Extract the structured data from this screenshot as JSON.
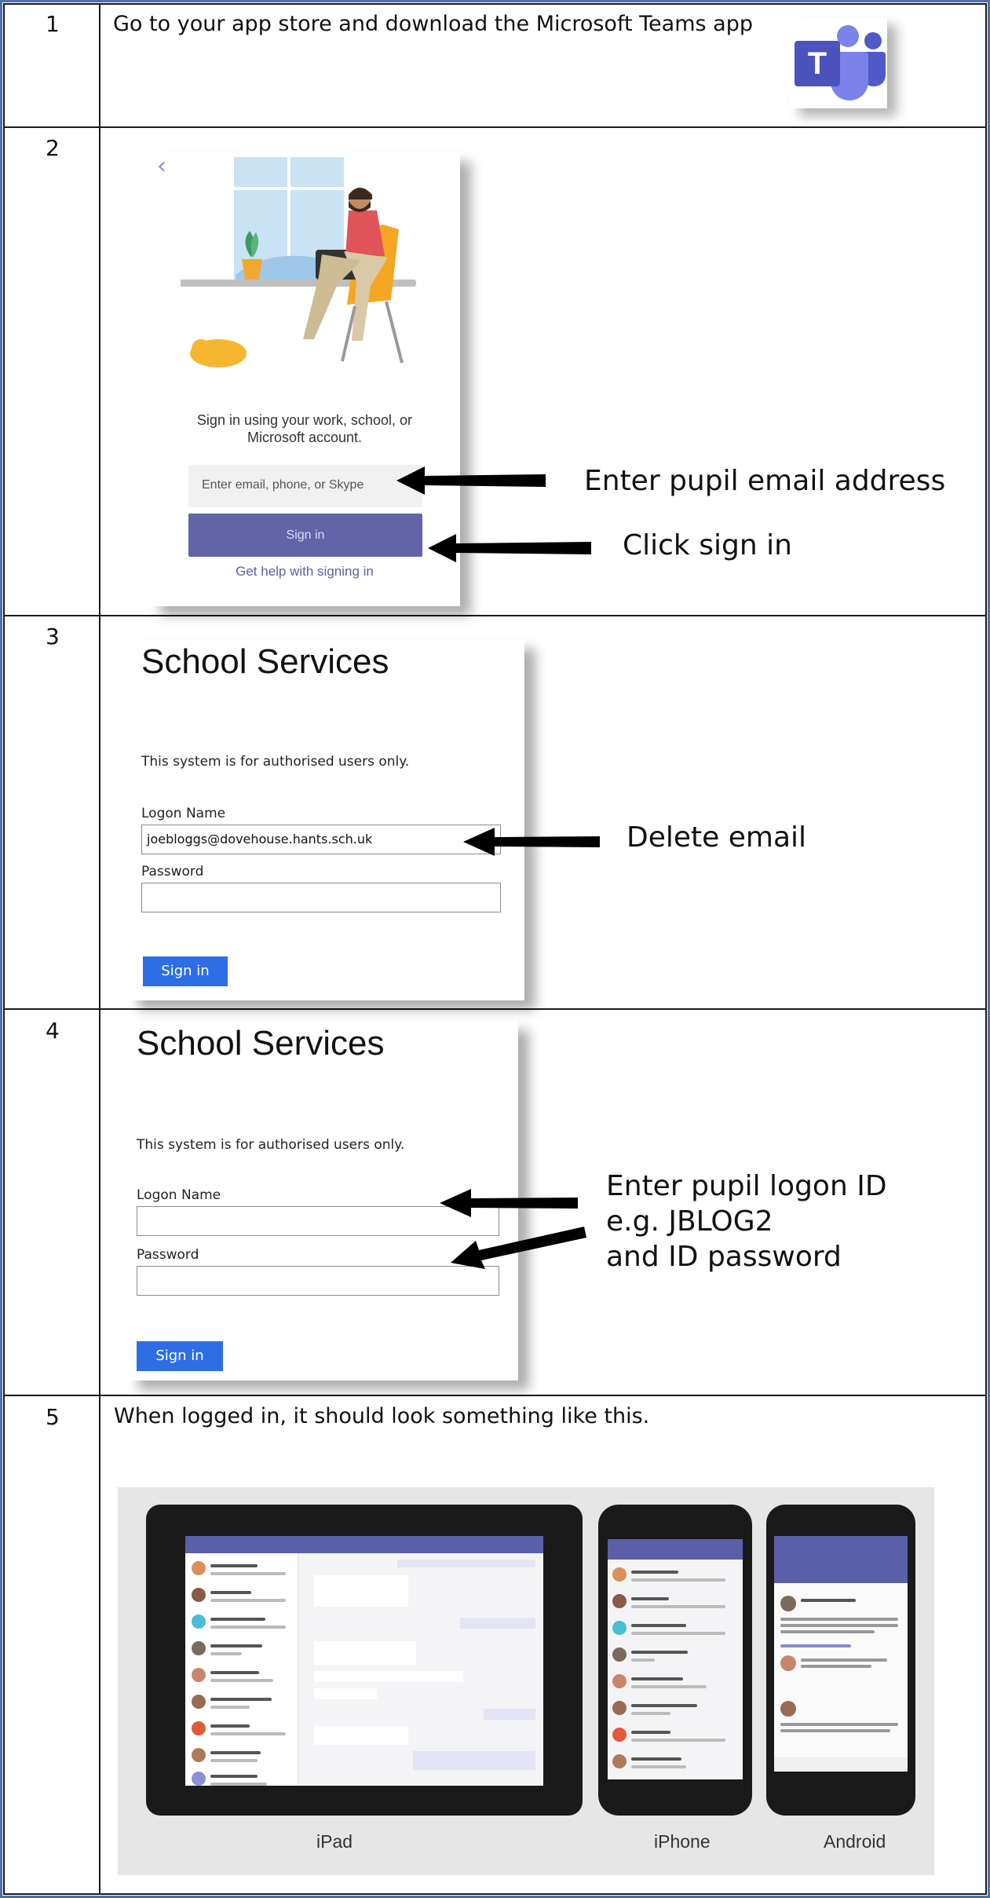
{
  "steps": [
    {
      "number": "1",
      "text": "Go to your app store and download the Microsoft Teams app"
    },
    {
      "number": "2",
      "annotations": [
        "Enter pupil email address",
        "Click sign in"
      ]
    },
    {
      "number": "3",
      "annotations": [
        "Delete email"
      ]
    },
    {
      "number": "4",
      "annotations": [
        "Enter pupil logon ID",
        "e.g. JBLOG2",
        "and ID password"
      ]
    },
    {
      "number": "5",
      "text": "When logged in, it should look something like this."
    }
  ],
  "teams_signin": {
    "prompt_line1": "Sign in using your work, school, or",
    "prompt_line2": "Microsoft account.",
    "input_placeholder": "Enter email, phone, or Skype",
    "button_label": "Sign in",
    "help_link": "Get help with signing in"
  },
  "school_services_step3": {
    "title": "School Services",
    "notice": "This system is for authorised users only.",
    "logon_label": "Logon Name",
    "logon_value": "joebloggs@dovehouse.hants.sch.uk",
    "password_label": "Password",
    "button_label": "Sign in"
  },
  "school_services_step4": {
    "title": "School Services",
    "notice": "This system is for authorised users only.",
    "logon_label": "Logon Name",
    "logon_value": "",
    "password_label": "Password",
    "button_label": "Sign in"
  },
  "devices": {
    "labels": [
      "iPad",
      "iPhone",
      "Android"
    ]
  },
  "colors": {
    "teams_purple": "#6264a7",
    "sign_in_blue": "#2d6ee6",
    "frame_blue": "#4f6fa8"
  }
}
